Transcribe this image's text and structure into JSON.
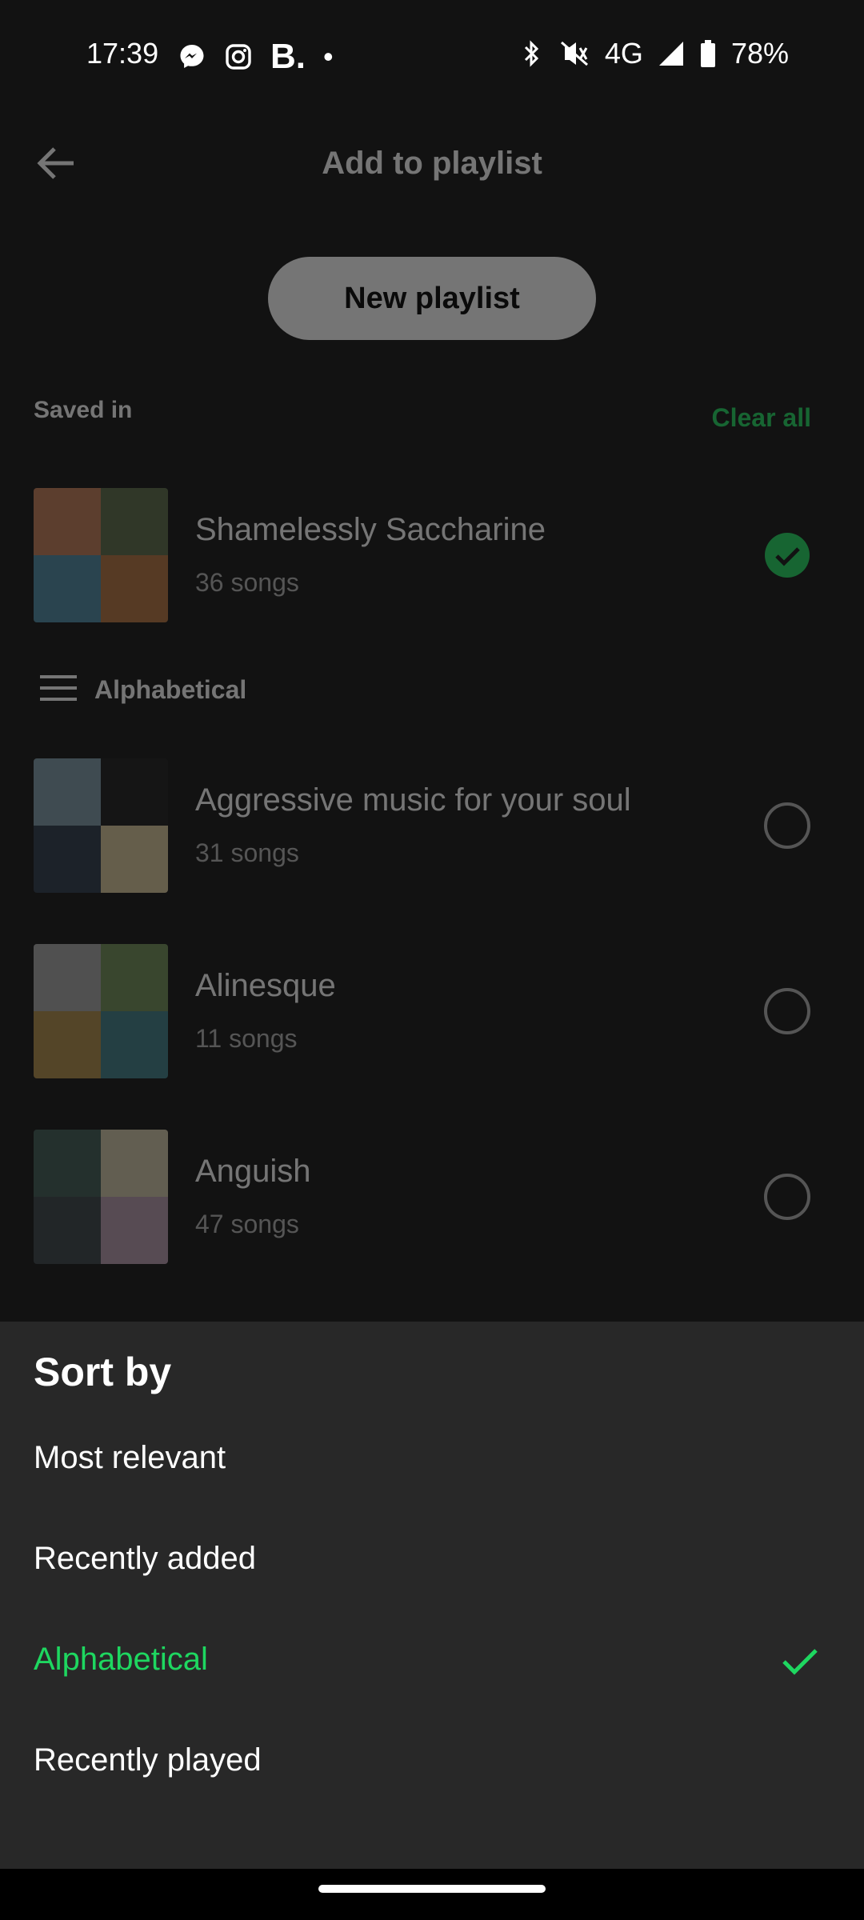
{
  "status_bar": {
    "time": "17:39",
    "b_label": "B.",
    "dot": "•",
    "network": "4G",
    "battery": "78%",
    "icons": [
      "messenger-icon",
      "instagram-icon",
      "bluetooth-icon",
      "vibrate-off-icon",
      "signal-icon",
      "battery-icon"
    ]
  },
  "header": {
    "title": "Add to playlist",
    "back_icon": "arrow-left-icon"
  },
  "new_playlist_label": "New playlist",
  "saved_section": {
    "label": "Saved in",
    "clear_all": "Clear all"
  },
  "saved_playlists": [
    {
      "name": "Shamelessly Saccharine",
      "count": "36 songs",
      "checked": true,
      "cover_colors": [
        "#c27b55",
        "#5a6b48",
        "#4b8aa3",
        "#b5713e"
      ]
    }
  ],
  "sort_header_label": "Alphabetical",
  "playlists": [
    {
      "name": "Aggressive music for your soul",
      "count": "31 songs",
      "checked": false,
      "cover_colors": [
        "#7e9aa8",
        "#1b1b1b",
        "#2c3a4a",
        "#d8c79b"
      ]
    },
    {
      "name": "Alinesque",
      "count": "11 songs",
      "checked": false,
      "cover_colors": [
        "#a7a7a7",
        "#6f8f55",
        "#b08b48",
        "#3e7f88"
      ]
    },
    {
      "name": "Anguish",
      "count": "47 songs",
      "checked": false,
      "cover_colors": [
        "#3f5a54",
        "#d1c8a8",
        "#3a4348",
        "#b79aae"
      ]
    }
  ],
  "sort_sheet": {
    "title": "Sort by",
    "options": [
      {
        "label": "Most relevant",
        "selected": false
      },
      {
        "label": "Recently added",
        "selected": false
      },
      {
        "label": "Alphabetical",
        "selected": true
      },
      {
        "label": "Recently played",
        "selected": false
      }
    ]
  },
  "colors": {
    "accent": "#1ed760",
    "background": "#121212",
    "sheet": "#282828"
  }
}
